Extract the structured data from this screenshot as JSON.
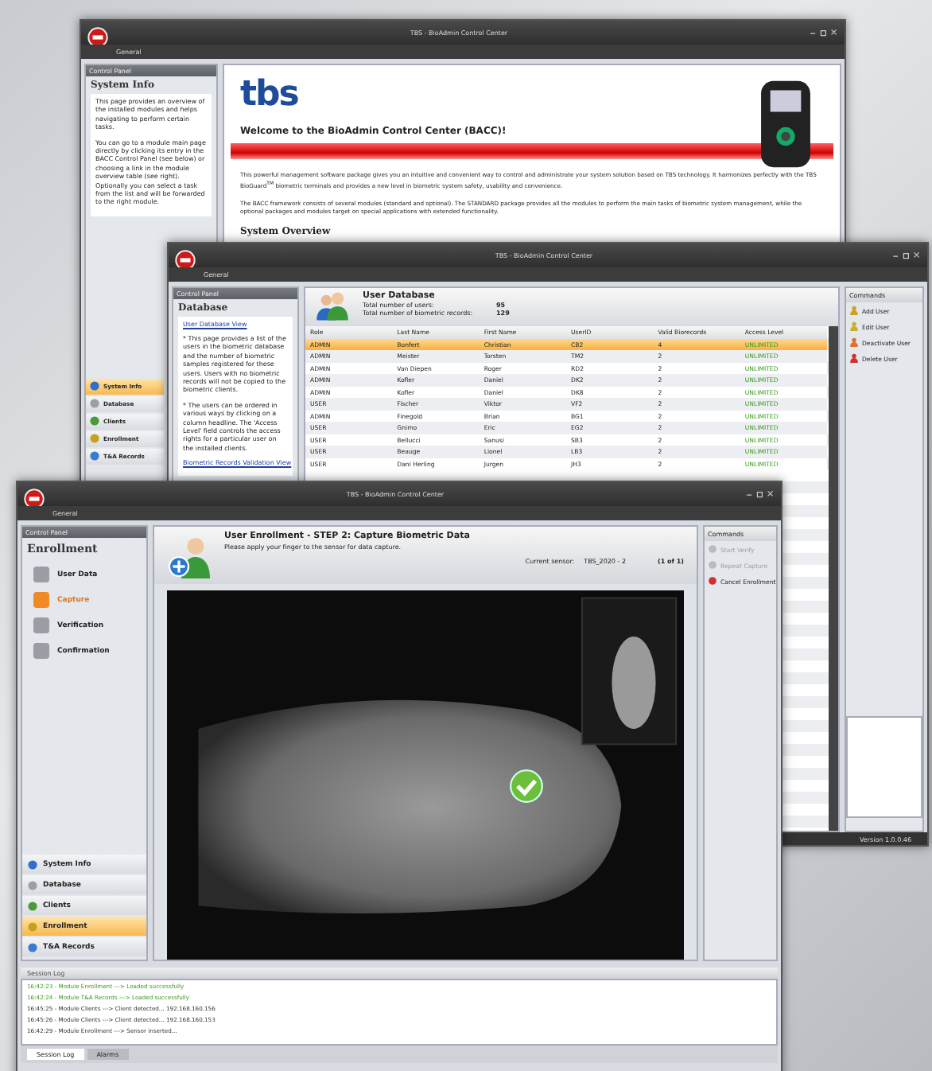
{
  "system_info_window": {
    "title": "TBS - BioAdmin Control Center",
    "menu": [
      "General"
    ],
    "panel_title": "Control Panel",
    "section": "System Info",
    "description": [
      "This page provides an overview of the installed modules and helps navigating to perform certain tasks.",
      "You can go to a module main page directly by clicking its entry in the BACC Control Panel (see below) or choosing a link in the module overview table (see right). Optionally you can select a task from the list and will be forwarded to the right module."
    ],
    "nav": [
      {
        "label": "System Info",
        "selected": true
      },
      {
        "label": "Database",
        "selected": false
      },
      {
        "label": "Clients",
        "selected": false
      },
      {
        "label": "Enrollment",
        "selected": false
      },
      {
        "label": "T&A Records",
        "selected": false
      }
    ],
    "logo_text": "tbs",
    "welcome": "Welcome to the **BioAdmin** Control Center (BACC)!",
    "paragraphs": [
      "This powerful management software package gives you an intuitive and convenient way to control and administrate your system solution based on TBS technology. It harmonizes perfectly with the TBS BioGuard$^{TM}$ biometric terminals and provides a new level in biometric system safety, usability and convenience.",
      "The BACC framework consists of several modules (standard and optional). The STANDARD package provides all the modules to perform the main tasks of biometric system management, while the optional packages and modules target on special applications with extended functionality."
    ],
    "heading": "System Overview"
  },
  "database_window": {
    "title": "TBS - BioAdmin Control Center",
    "menu": [
      "General"
    ],
    "panel_title": "Control Panel",
    "section": "Database",
    "link": "User Database View",
    "description": [
      "* This page provides a list of the users in the biometric database and the number of biometric samples registered for these users. Users with no biometric records will not be copied to the biometric clients.",
      "* The users can be ordered in various ways by clicking on a column headline. The 'Access Level' field controls the access rights for a particular user on the installed clients."
    ],
    "link2": "Biometric Records Validation View",
    "header_title": "User Database",
    "stats": [
      {
        "label": "Total number of users:",
        "value": "95"
      },
      {
        "label": "Total number of biometric records:",
        "value": "129"
      }
    ],
    "table": {
      "columns": [
        "Role",
        "Last Name",
        "First Name",
        "UserID",
        "Valid Biorecords",
        "Access Level"
      ],
      "rows": [
        {
          "cells": [
            "ADMIN",
            "Bonfert",
            "Christian",
            "CB2",
            "4",
            "UNLIMITED"
          ],
          "selected": true
        },
        {
          "cells": [
            "ADMIN",
            "Meister",
            "Torsten",
            "TM2",
            "2",
            "UNLIMITED"
          ],
          "selected": false
        },
        {
          "cells": [
            "ADMIN",
            "Van Diepen",
            "Roger",
            "RD2",
            "2",
            "UNLIMITED"
          ],
          "selected": false
        },
        {
          "cells": [
            "ADMIN",
            "Kofler",
            "Daniel",
            "DK2",
            "2",
            "UNLIMITED"
          ],
          "selected": false
        },
        {
          "cells": [
            "ADMIN",
            "Kofler",
            "Daniel",
            "DK8",
            "2",
            "UNLIMITED"
          ],
          "selected": false
        },
        {
          "cells": [
            "USER",
            "Fischer",
            "Viktor",
            "VF2",
            "2",
            "UNLIMITED"
          ],
          "selected": false
        },
        {
          "cells": [
            "ADMIN",
            "Finegold",
            "Brian",
            "BG1",
            "2",
            "UNLIMITED"
          ],
          "selected": false
        },
        {
          "cells": [
            "USER",
            "Gnimo",
            "Eric",
            "EG2",
            "2",
            "UNLIMITED"
          ],
          "selected": false
        },
        {
          "cells": [
            "USER",
            "Bellucci",
            "Sanusi",
            "SB3",
            "2",
            "UNLIMITED"
          ],
          "selected": false
        },
        {
          "cells": [
            "USER",
            "Beauge",
            "Lionel",
            "LB3",
            "2",
            "UNLIMITED"
          ],
          "selected": false
        },
        {
          "cells": [
            "USER",
            "Dani Herling",
            "Jurgen",
            "JH3",
            "2",
            "UNLIMITED"
          ],
          "selected": false
        }
      ]
    },
    "commands_title": "Commands",
    "commands": [
      "Add User",
      "Edit User",
      "Deactivate User",
      "Delete User"
    ],
    "version": "Version 1.0.0.46"
  },
  "enrollment_window": {
    "title": "TBS - BioAdmin Control Center",
    "menu": [
      "General"
    ],
    "panel_title": "Control Panel",
    "section": "Enrollment",
    "steps": [
      {
        "label": "User Data",
        "selected": false
      },
      {
        "label": "Capture",
        "selected": true
      },
      {
        "label": "Verification",
        "selected": false
      },
      {
        "label": "Confirmation",
        "selected": false
      }
    ],
    "header_title": "User Enrollment - STEP 2: Capture Biometric Data",
    "subtitle": "Please apply your finger to the sensor for data capture.",
    "sensor_label": "Current sensor:",
    "sensor": "TBS_2020 - 2",
    "count": "(1 of 1)",
    "commands_title": "Commands",
    "commands": [
      {
        "label": "Start Verify",
        "disabled": true
      },
      {
        "label": "Repeat Capture",
        "disabled": true
      },
      {
        "label": "Cancel Enrollment",
        "disabled": false
      }
    ],
    "nav": [
      {
        "label": "System Info",
        "selected": false
      },
      {
        "label": "Database",
        "selected": false
      },
      {
        "label": "Clients",
        "selected": false
      },
      {
        "label": "Enrollment",
        "selected": true
      },
      {
        "label": "T&A Records",
        "selected": false
      }
    ],
    "log_title": "Session Log",
    "log": [
      {
        "text": "16:42:23 - Module Enrollment ---> Loaded successfully",
        "kind": "success"
      },
      {
        "text": "16:42:24 - Module T&A Records ---> Loaded successfully",
        "kind": "success"
      },
      {
        "text": "16:45:25 - Module Clients ---> Client detected... 192.168.160.156",
        "kind": "info"
      },
      {
        "text": "16:45:26 - Module Clients ---> Client detected... 192.168.160.153",
        "kind": "info"
      },
      {
        "text": "16:42:29 - Module Enrollment ---> Sensor inserted...",
        "kind": "info"
      }
    ],
    "tabs": [
      {
        "label": "Session Log",
        "selected": true
      },
      {
        "label": "Alarms",
        "selected": false
      }
    ]
  }
}
